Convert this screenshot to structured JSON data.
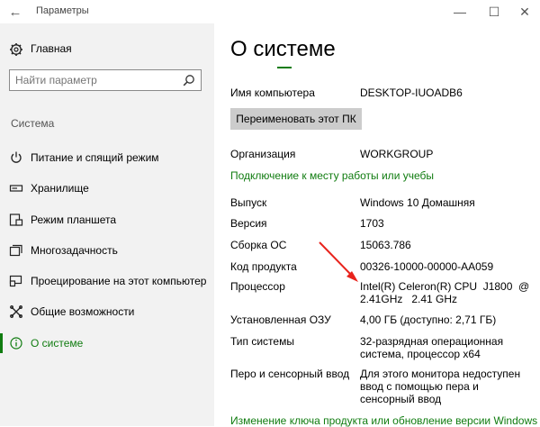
{
  "window": {
    "title": "Параметры",
    "back_glyph": "←",
    "minimize_glyph": "—",
    "maximize_glyph": "☐",
    "close_glyph": "✕"
  },
  "sidebar": {
    "home_label": "Главная",
    "search_placeholder": "Найти параметр",
    "section_label": "Система",
    "items": [
      {
        "label": "Питание и спящий режим",
        "icon": "power-icon"
      },
      {
        "label": "Хранилище",
        "icon": "storage-icon"
      },
      {
        "label": "Режим планшета",
        "icon": "tablet-mode-icon"
      },
      {
        "label": "Многозадачность",
        "icon": "multitasking-icon"
      },
      {
        "label": "Проецирование на этот компьютер",
        "icon": "projecting-icon"
      },
      {
        "label": "Общие возможности",
        "icon": "shared-experiences-icon"
      },
      {
        "label": "О системе",
        "icon": "info-icon",
        "active": true
      }
    ]
  },
  "main": {
    "title": "О системе",
    "device_name": {
      "label": "Имя компьютера",
      "value": "DESKTOP-IUOADB6"
    },
    "rename_button": "Переименовать этот ПК",
    "organization": {
      "label": "Организация",
      "value": "WORKGROUP"
    },
    "connect_link": "Подключение к месту работы или учебы",
    "edition": {
      "label": "Выпуск",
      "value": "Windows 10 Домашняя"
    },
    "version": {
      "label": "Версия",
      "value": "1703"
    },
    "os_build": {
      "label": "Сборка ОС",
      "value": "15063.786"
    },
    "product_id": {
      "label": "Код продукта",
      "value": "00326-10000-00000-AA059"
    },
    "processor": {
      "label": "Процессор",
      "value_line1": "Intel(R) Celeron(R) CPU  J1800  @",
      "value_line2": "2.41GHz   2.41 GHz"
    },
    "ram": {
      "label": "Установленная ОЗУ",
      "value": "4,00 ГБ (доступно: 2,71 ГБ)"
    },
    "system_type": {
      "label": "Тип системы",
      "value_line1": "32-разрядная операционная",
      "value_line2": "система, процессор x64"
    },
    "pen_touch": {
      "label": "Перо и сенсорный ввод",
      "value_line1": "Для этого монитора недоступен",
      "value_line2": "ввод с помощью пера и",
      "value_line3": "сенсорный ввод"
    },
    "product_key_link": "Изменение ключа продукта или обновление версии Windows"
  },
  "colors": {
    "accent": "#107c10",
    "arrow": "#e8231c",
    "sidebar_bg": "#f2f2f2"
  }
}
